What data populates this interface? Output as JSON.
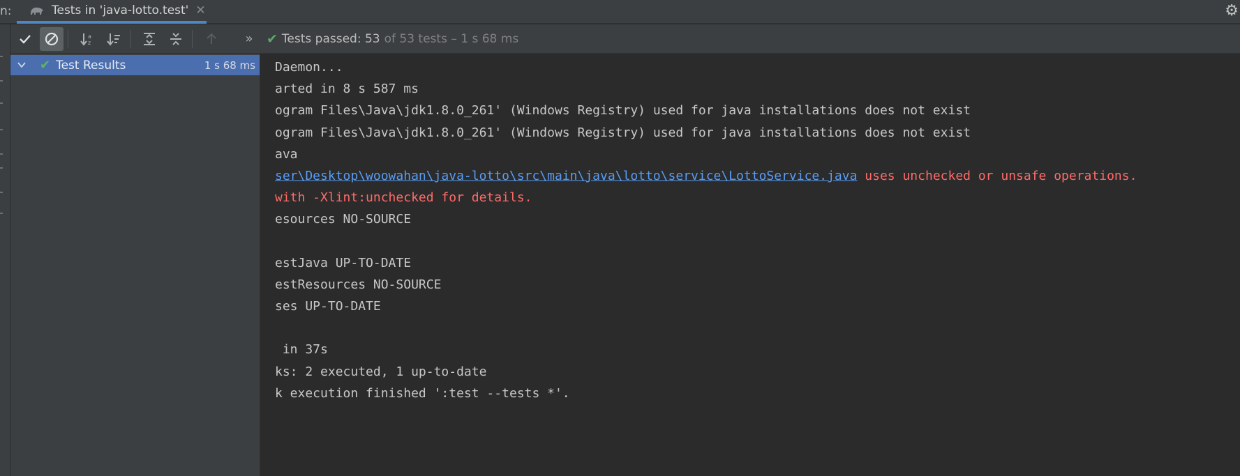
{
  "tabbar": {
    "run_label": "n:",
    "tab_title": "Tests in 'java-lotto.test'",
    "close_symbol": "✕",
    "gear_symbol": "⚙"
  },
  "toolbar": {
    "show_passed_icon": "check-icon",
    "show_ignored_icon": "ban-icon",
    "sort_alpha_icon": "sort-alpha-icon",
    "sort_duration_icon": "sort-duration-icon",
    "expand_all_icon": "expand-all-icon",
    "collapse_all_icon": "collapse-all-icon",
    "prev_failed_icon": "arrow-up-icon",
    "more_icon": "chevron-double-right-icon",
    "more_symbol": "»",
    "status_passed": "Tests passed: 53",
    "status_rest": "of 53 tests – 1 s 68 ms"
  },
  "tree": {
    "root_label": "Test Results",
    "root_time": "1 s 68 ms"
  },
  "console": {
    "lines": [
      {
        "text": "Daemon...",
        "kind": "normal"
      },
      {
        "text": "arted in 8 s 587 ms",
        "kind": "normal"
      },
      {
        "text": "ogram Files\\Java\\jdk1.8.0_261' (Windows Registry) used for java installations does not exist",
        "kind": "normal"
      },
      {
        "text": "ogram Files\\Java\\jdk1.8.0_261' (Windows Registry) used for java installations does not exist",
        "kind": "normal"
      },
      {
        "text": "ava",
        "kind": "normal"
      },
      {
        "link": "ser\\Desktop\\woowahan\\java-lotto\\src\\main\\java\\lotto\\service\\LottoService.java",
        "text": " uses unchecked or unsafe operations.",
        "kind": "link-error"
      },
      {
        "text": "with -Xlint:unchecked for details.",
        "kind": "error"
      },
      {
        "text": "esources NO-SOURCE",
        "kind": "normal"
      },
      {
        "text": "",
        "kind": "normal"
      },
      {
        "text": "estJava UP-TO-DATE",
        "kind": "normal"
      },
      {
        "text": "estResources NO-SOURCE",
        "kind": "normal"
      },
      {
        "text": "ses UP-TO-DATE",
        "kind": "normal"
      },
      {
        "text": "",
        "kind": "normal"
      },
      {
        "text": " in 37s",
        "kind": "normal"
      },
      {
        "text": "ks: 2 executed, 1 up-to-date",
        "kind": "normal"
      },
      {
        "text": "k execution finished ':test --tests *'.",
        "kind": "normal"
      }
    ]
  },
  "colors": {
    "accent": "#4a88c7",
    "selection": "#4b6eaf",
    "pass": "#59a869",
    "error": "#ff6b68",
    "link": "#589df6"
  }
}
